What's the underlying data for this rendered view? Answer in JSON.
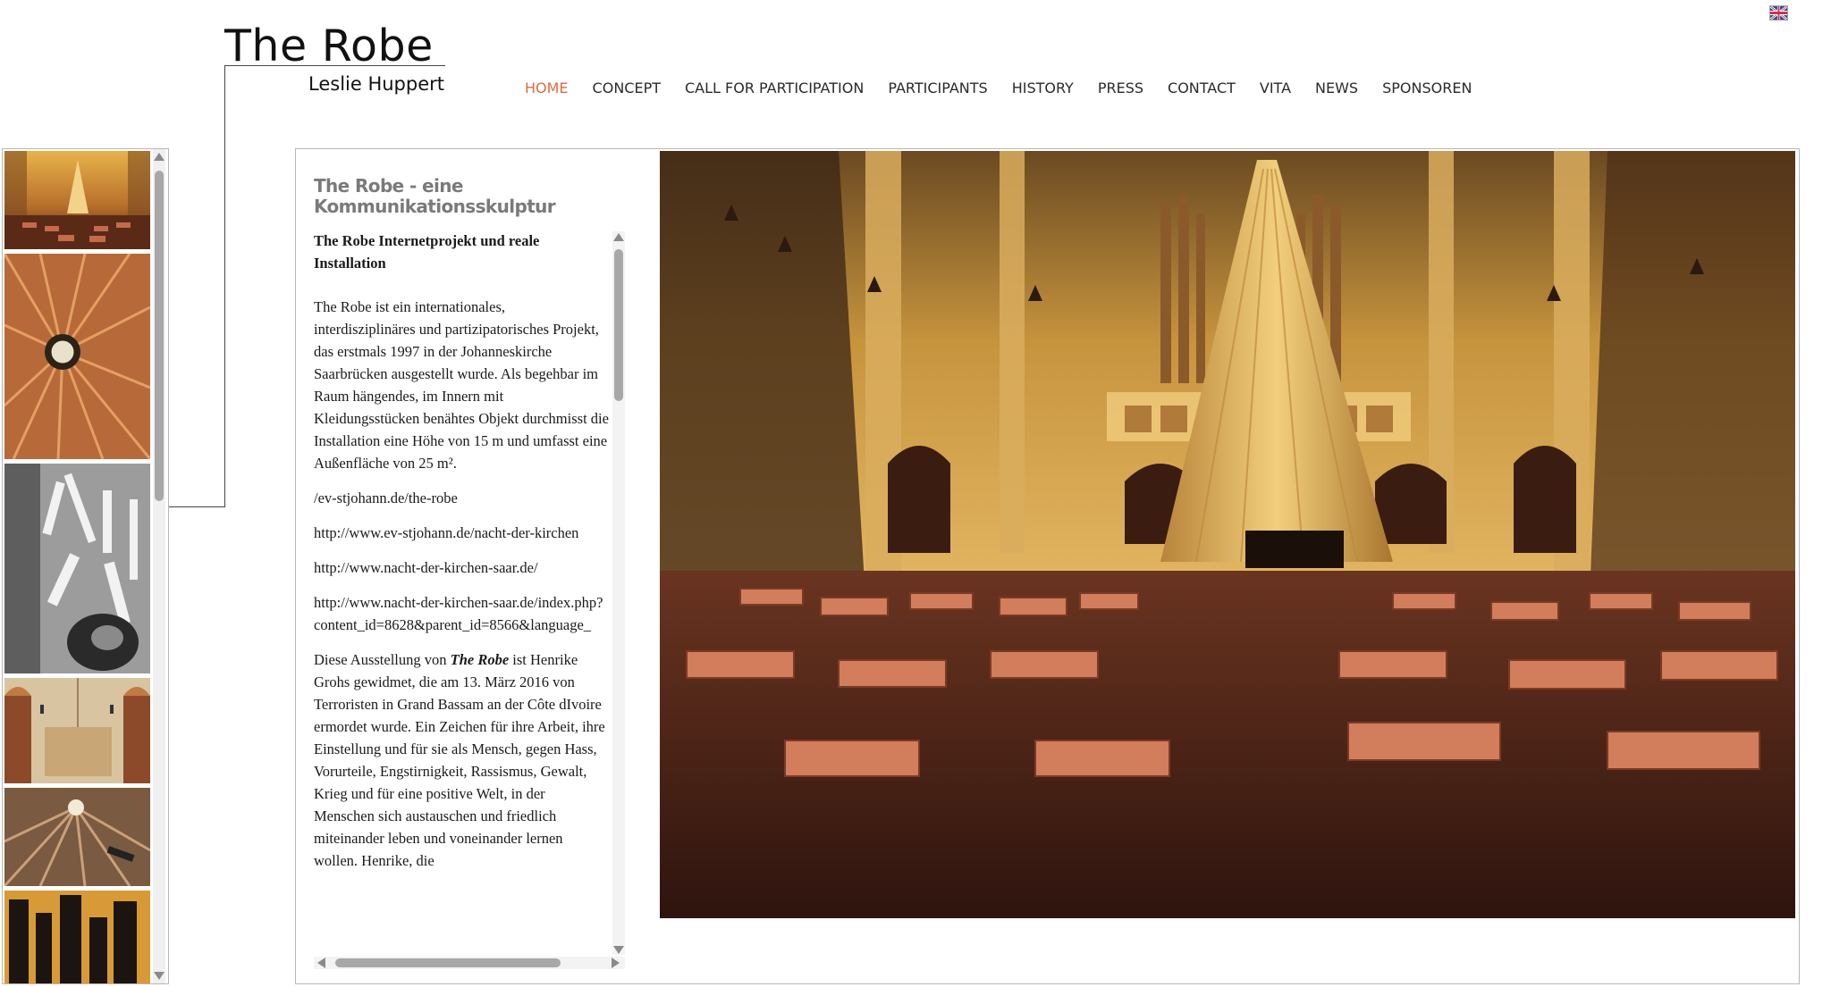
{
  "site": {
    "title": "The Robe",
    "subtitle": "Leslie Huppert",
    "language_flag_icon": "uk-flag-icon"
  },
  "nav": {
    "items": [
      {
        "label": "HOME",
        "active": true
      },
      {
        "label": "CONCEPT",
        "active": false
      },
      {
        "label": "CALL FOR PARTICIPATION",
        "active": false
      },
      {
        "label": "PARTICIPANTS",
        "active": false
      },
      {
        "label": "HISTORY",
        "active": false
      },
      {
        "label": "PRESS",
        "active": false
      },
      {
        "label": "CONTACT",
        "active": false
      },
      {
        "label": "VITA",
        "active": false
      },
      {
        "label": "NEWS",
        "active": false
      },
      {
        "label": "SPONSOREN",
        "active": false
      }
    ],
    "active_color": "#e06a3c"
  },
  "thumbnails": [
    {
      "name": "church-interior-thumb"
    },
    {
      "name": "robe-looking-up-thumb"
    },
    {
      "name": "hanging-garments-thumb"
    },
    {
      "name": "robe-hem-thumb"
    },
    {
      "name": "robe-tunnel-thumb"
    },
    {
      "name": "dark-garments-thumb"
    }
  ],
  "article": {
    "title": "The Robe - eine Kommunikationsskulptur",
    "subhead": "The Robe Internetprojekt und reale Installation",
    "paragraph1": "The Robe ist ein internationales, interdisziplinäres und partizipatorisches Projekt, das erstmals 1997 in der Johanneskirche Saarbrücken ausgestellt wurde. Als begehbar im Raum hängendes, im Innern mit Kleidungsstücken benähtes Objekt durchmisst die Installation eine Höhe von 15 m und umfasst eine Außenfläche von 25 m².",
    "link1": "/ev-stjohann.de/the-robe",
    "link2": "http://www.ev-stjohann.de/nacht-der-kirchen",
    "link3": "http://www.nacht-der-kirchen-saar.de/",
    "link4": "http://www.nacht-der-kirchen-saar.de/index.php?content_id=8628&parent_id=8566&language_",
    "dedication_prefix": "Diese Ausstellung von ",
    "dedication_work": "The Robe",
    "dedication_rest": " ist Henrike Grohs gewidmet, die am 13. März 2016 von Terroristen in Grand Bassam an der Côte dIvoire ermordet wurde. Ein Zeichen für ihre Arbeit, ihre Einstellung und für sie als Mensch, gegen Hass, Vorurteile, Engstirnigkeit, Rassismus, Gewalt, Krieg und für eine positive Welt, in der Menschen sich austauschen und friedlich miteinander leben und voneinander lernen wollen. Henrike, die"
  },
  "hero_image": {
    "name": "church-installation-photo"
  }
}
